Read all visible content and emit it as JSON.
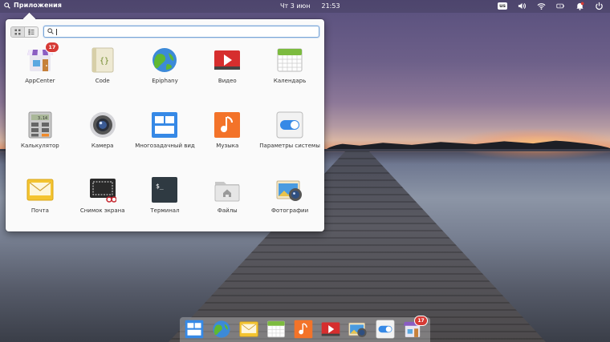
{
  "panel": {
    "applications_label": "Приложения",
    "date": "Чт 3 июн",
    "time": "21:53",
    "keyboard_layout": "us",
    "tray_icons": [
      "volume-icon",
      "network-icon",
      "battery-icon",
      "notifications-icon",
      "power-icon"
    ]
  },
  "menu": {
    "search": {
      "value": "",
      "placeholder": ""
    },
    "view_modes": [
      "grid-view-icon",
      "category-view-icon"
    ],
    "apps": [
      {
        "label": "AppCenter",
        "icon": "appcenter-icon",
        "badge": "17"
      },
      {
        "label": "Code",
        "icon": "code-icon"
      },
      {
        "label": "Epiphany",
        "icon": "epiphany-icon"
      },
      {
        "label": "Видео",
        "icon": "video-icon"
      },
      {
        "label": "Календарь",
        "icon": "calendar-icon"
      },
      {
        "label": "Калькулятор",
        "icon": "calculator-icon"
      },
      {
        "label": "Камера",
        "icon": "camera-icon"
      },
      {
        "label": "Многозадачный вид",
        "icon": "multitasking-view-icon"
      },
      {
        "label": "Музыка",
        "icon": "music-icon"
      },
      {
        "label": "Параметры системы",
        "icon": "system-settings-icon"
      },
      {
        "label": "Почта",
        "icon": "mail-icon"
      },
      {
        "label": "Снимок экрана",
        "icon": "screenshot-icon"
      },
      {
        "label": "Терминал",
        "icon": "terminal-icon"
      },
      {
        "label": "Файлы",
        "icon": "files-icon"
      },
      {
        "label": "Фотографии",
        "icon": "photos-icon"
      }
    ],
    "calculator_display": "3.14",
    "terminal_prompt": "$_"
  },
  "dock": {
    "items": [
      {
        "icon": "multitasking-view-icon"
      },
      {
        "icon": "epiphany-icon"
      },
      {
        "icon": "mail-icon"
      },
      {
        "icon": "calendar-icon"
      },
      {
        "icon": "music-icon"
      },
      {
        "icon": "video-icon"
      },
      {
        "icon": "photos-icon"
      },
      {
        "icon": "system-settings-icon"
      },
      {
        "icon": "appcenter-icon",
        "badge": "17"
      }
    ]
  },
  "colors": {
    "accent": "#3689e6",
    "badge": "#d63a35",
    "menu_bg": "#fafafa"
  }
}
